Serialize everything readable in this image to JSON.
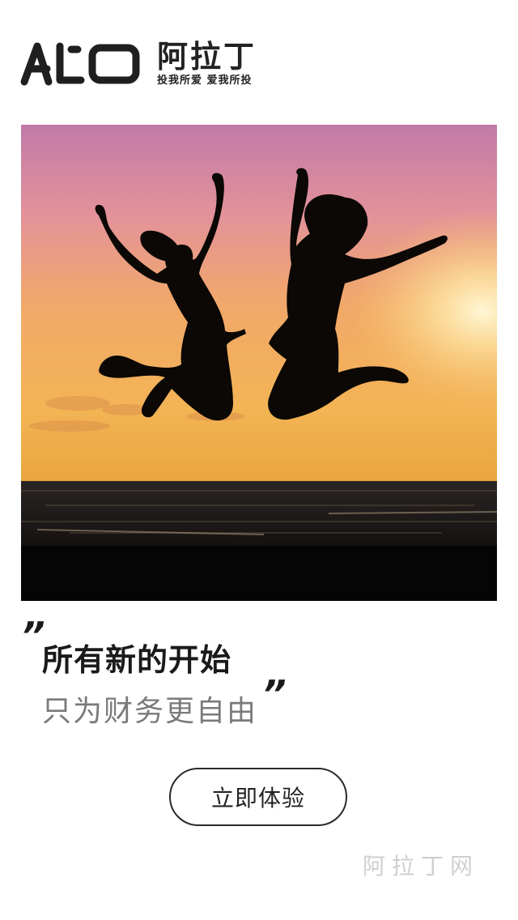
{
  "brand": {
    "logo_letters": "ALO",
    "name_cn": "阿拉丁",
    "slogan": "投我所爱 爱我所投"
  },
  "hero": {
    "image_alt": "Two people jumping silhouetted against a sunset over the sea"
  },
  "headline": {
    "open_quote": "”",
    "line1": "所有新的开始",
    "line2": "只为财务更自由",
    "close_quote": "”"
  },
  "cta": {
    "label": "立即体验"
  },
  "watermark": {
    "text": "阿拉丁网"
  },
  "colors": {
    "text_primary": "#1a1a1a",
    "text_secondary": "#7a7a7a",
    "sky_top": "#c685b0",
    "sky_mid": "#f0a060",
    "sky_low": "#f6c257",
    "sea": "#141414"
  }
}
